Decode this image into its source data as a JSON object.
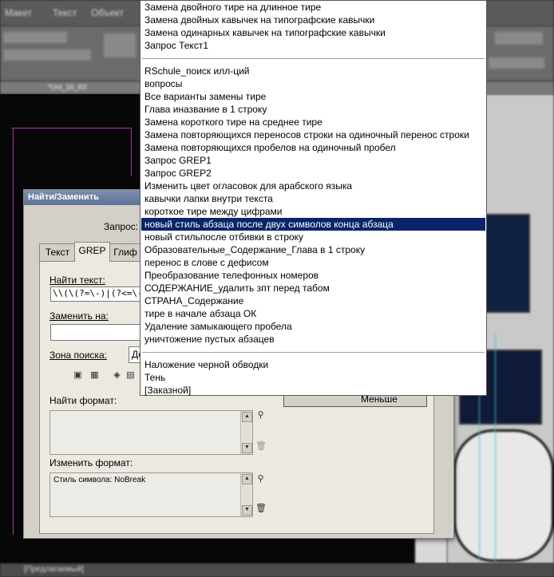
{
  "app": {
    "menubar": [
      "Макет",
      "Текст",
      "Объект"
    ],
    "doc_tab_fragment": "*Unt_16_K0",
    "status_text": "[Предлагаемый]"
  },
  "dialog": {
    "title": "Найти/Заменить",
    "query_label": "Запрос:",
    "tabs": [
      "Текст",
      "GREP",
      "Глиф"
    ],
    "active_tab": "GREP",
    "find_label": "Найти текст:",
    "find_value": "\\\\(\\(?=\\-)|(?<=\\-)\\\\",
    "replace_label": "Заменить на:",
    "replace_value": "",
    "search_zone_label": "Зона поиска:",
    "search_zone_value": "До",
    "find_format_label": "Найти формат:",
    "find_format_value": "",
    "change_format_label": "Изменить формат:",
    "change_format_value": "Стиль символа: NoBreak",
    "fewer_button": "Меньше",
    "icons": [
      "locked-layers-icon",
      "locked-stories-icon",
      "hidden-layers-icon",
      "master-pages-icon",
      "footnotes-icon"
    ]
  },
  "menu": {
    "groups": [
      [
        "Замена двойного тире на длинное тире",
        "Замена двойных кавычек на типографские кавычки",
        "Замена одинарных кавычек на типографские кавычки",
        "Запрос Текст1"
      ],
      [
        "RSchule_поиск илл-ций",
        "вопросы",
        "Все варианты замены тире",
        "Глава иназвание в 1 строку",
        "Замена короткого тире на среднее тире",
        "Замена повторяющихся переносов строки на одиночный перенос строки",
        "Замена повторяющихся пробелов на одиночный пробел",
        "Запрос GREP1",
        "Запрос GREP2",
        "Изменить цвет огласовок для арабского языка",
        "кавычки лапки внутри текста",
        "короткое тире между цифрами",
        "новый стиль абзаца после двух символов конца абзаца",
        "новый стильпосле отбивки в строку",
        "Образовательные_Содержание_Глава в 1 строку",
        "перенос в слове с дефисом",
        "Преобразование телефонных номеров",
        "СОДЕРЖАНИЕ_удалить зпт перед табом",
        "СТРАНА_Содержание",
        "тире в начале абзаца ОК",
        "Удаление замыкающего пробела",
        "уничтожение пустых абзацев"
      ],
      [
        "Наложение черной обводки",
        "Тень",
        "[Заказной]"
      ]
    ],
    "selected": "новый стиль абзаца после двух символов конца абзаца"
  }
}
